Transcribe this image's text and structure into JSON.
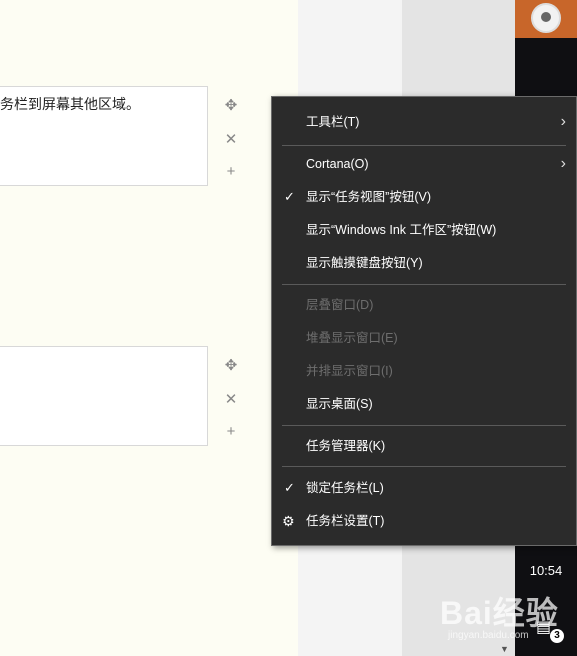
{
  "editor": {
    "box1_text": "务栏到屏幕其他区域。",
    "box2_text": ""
  },
  "menu": {
    "items": [
      {
        "label": "工具栏(T)",
        "submenu": true
      },
      {
        "label": "Cortana(O)",
        "submenu": true
      },
      {
        "label": "显示“任务视图”按钮(V)",
        "checked": true
      },
      {
        "label": "显示“Windows Ink 工作区”按钮(W)"
      },
      {
        "label": "显示触摸键盘按钮(Y)"
      },
      {
        "label": "层叠窗口(D)",
        "disabled": true
      },
      {
        "label": "堆叠显示窗口(E)",
        "disabled": true
      },
      {
        "label": "并排显示窗口(I)",
        "disabled": true
      },
      {
        "label": "显示桌面(S)"
      },
      {
        "label": "任务管理器(K)"
      },
      {
        "label": "锁定任务栏(L)",
        "checked": true
      },
      {
        "label": "任务栏设置(T)",
        "icon": "gear-icon"
      }
    ]
  },
  "taskbar": {
    "clock": "10:54",
    "notification_count": "3"
  },
  "watermark": {
    "text": "Bai经验",
    "sub": "jingyan.baidu.com"
  },
  "colors": {
    "menu_bg": "#2b2b2b",
    "taskbar_bg": "#0f0f12",
    "editor_bg": "#fdfdf3",
    "accent": "#c8662a"
  }
}
